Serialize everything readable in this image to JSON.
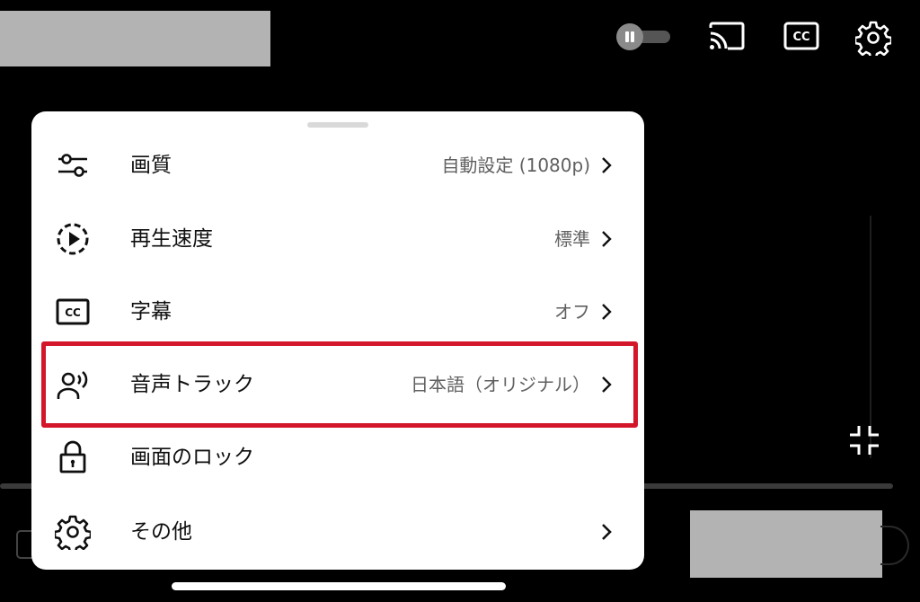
{
  "settings_menu": {
    "items": [
      {
        "label": "画質",
        "value": "自動設定 (1080p)",
        "icon": "sliders-icon"
      },
      {
        "label": "再生速度",
        "value": "標準",
        "icon": "playback-speed-icon"
      },
      {
        "label": "字幕",
        "value": "オフ",
        "icon": "closed-captions-icon"
      },
      {
        "label": "音声トラック",
        "value": "日本語（オリジナル）",
        "icon": "audio-track-icon"
      },
      {
        "label": "画面のロック",
        "value": "",
        "icon": "lock-icon"
      },
      {
        "label": "その他",
        "value": "",
        "icon": "gear-icon"
      }
    ]
  },
  "player_controls": {
    "autoplay": {
      "state": "on",
      "icon": "pause-icon"
    },
    "top_icons": [
      "cast-icon",
      "closed-captions-icon",
      "settings-icon"
    ],
    "bottom_icons": [
      "exit-fullscreen-icon"
    ]
  },
  "colors": {
    "background": "#000000",
    "menu_background": "#ffffff",
    "highlight": "#d3162a",
    "redaction": "#b3b3b3"
  }
}
